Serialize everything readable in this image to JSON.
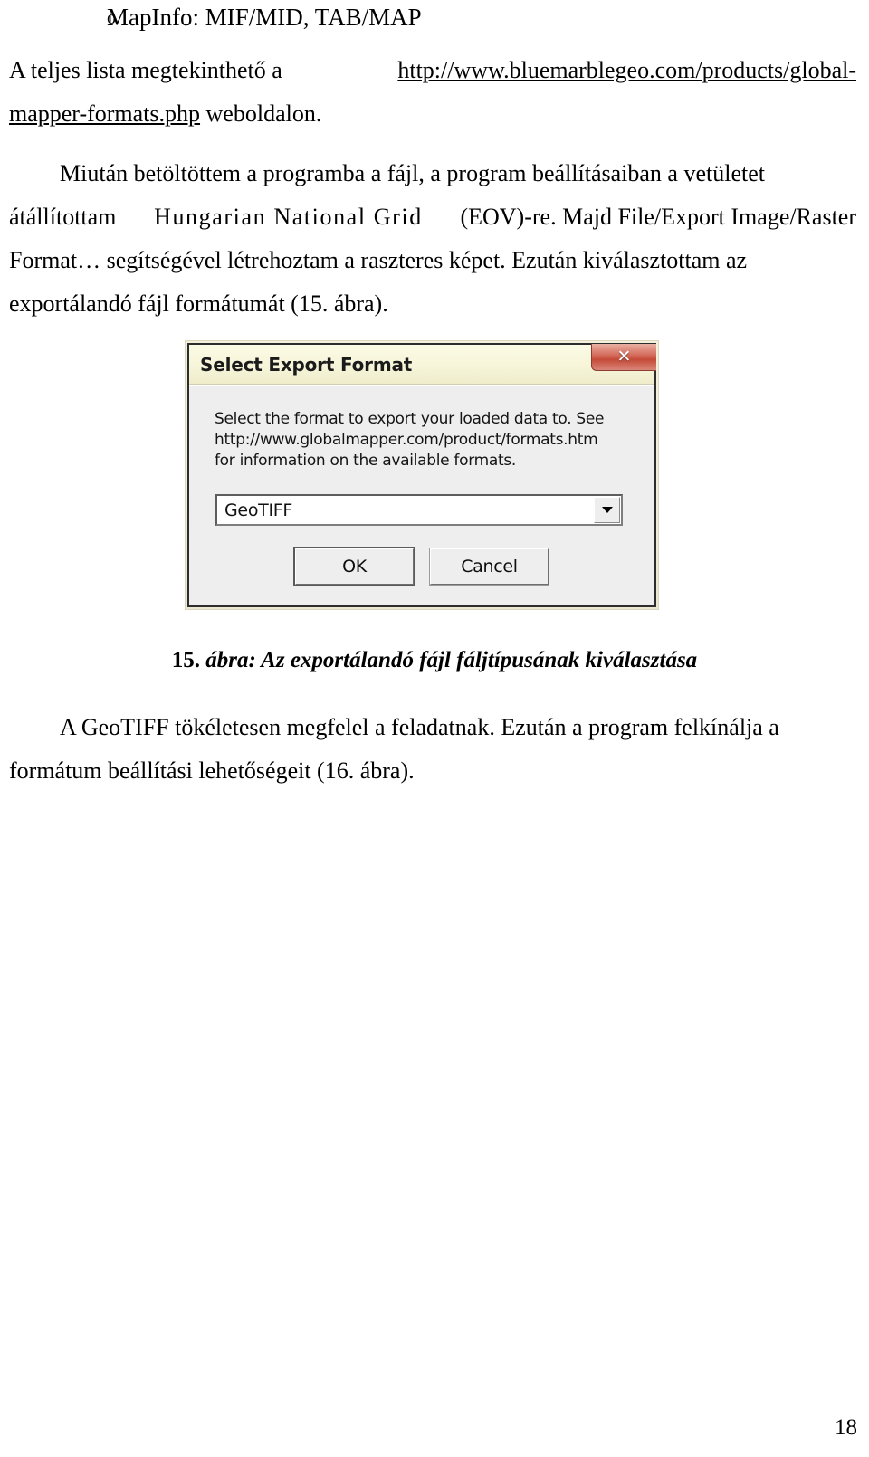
{
  "document": {
    "page_number": "18",
    "bullet_item": {
      "marker": "o",
      "text": "MapInfo: MIF/MID, TAB/MAP"
    },
    "paragraph_1": {
      "line1_before_link": "A teljes lista megtekinthető a ",
      "link_part1": "http://www.bluemarblegeo.com/products/global-",
      "link_part2": "mapper-formats.php",
      "line2_after_link": " weboldalon."
    },
    "paragraph_2": {
      "line1": "Miután betöltöttem a programba a fájl, a program beállításaiban a vetületet",
      "line2_a": "átállítottam ",
      "line2_spaced": "Hungarian National Grid",
      "line2_b": " (EOV)-re. Majd File/Export Image/Raster",
      "line3": "Format… segítségével létrehoztam a raszteres képet. Ezután kiválasztottam az",
      "line4": "exportálandó fájl formátumát (15. ábra)."
    },
    "figure_caption": {
      "number": "15. ",
      "text": "ábra: Az exportálandó fájl fáljtípusának kiválasztása"
    },
    "paragraph_3": {
      "line1": "A GeoTIFF tökéletesen megfelel a feladatnak. Ezután a program felkínálja a",
      "line2": "formátum beállítási lehetőségeit (16. ábra)."
    }
  },
  "dialog": {
    "title": "Select Export Format",
    "close_icon": "✕",
    "description_lines": [
      "Select the format to export your loaded data to. See",
      "http://www.globalmapper.com/product/formats.htm",
      "for information on the available formats."
    ],
    "combo": {
      "value": "GeoTIFF",
      "arrow_icon": "chevron-down-icon"
    },
    "buttons": {
      "ok": "OK",
      "cancel": "Cancel"
    },
    "colors": {
      "titlebar": "#f6f4d8",
      "close_button": "#c54b38",
      "body": "#efeeee"
    }
  }
}
